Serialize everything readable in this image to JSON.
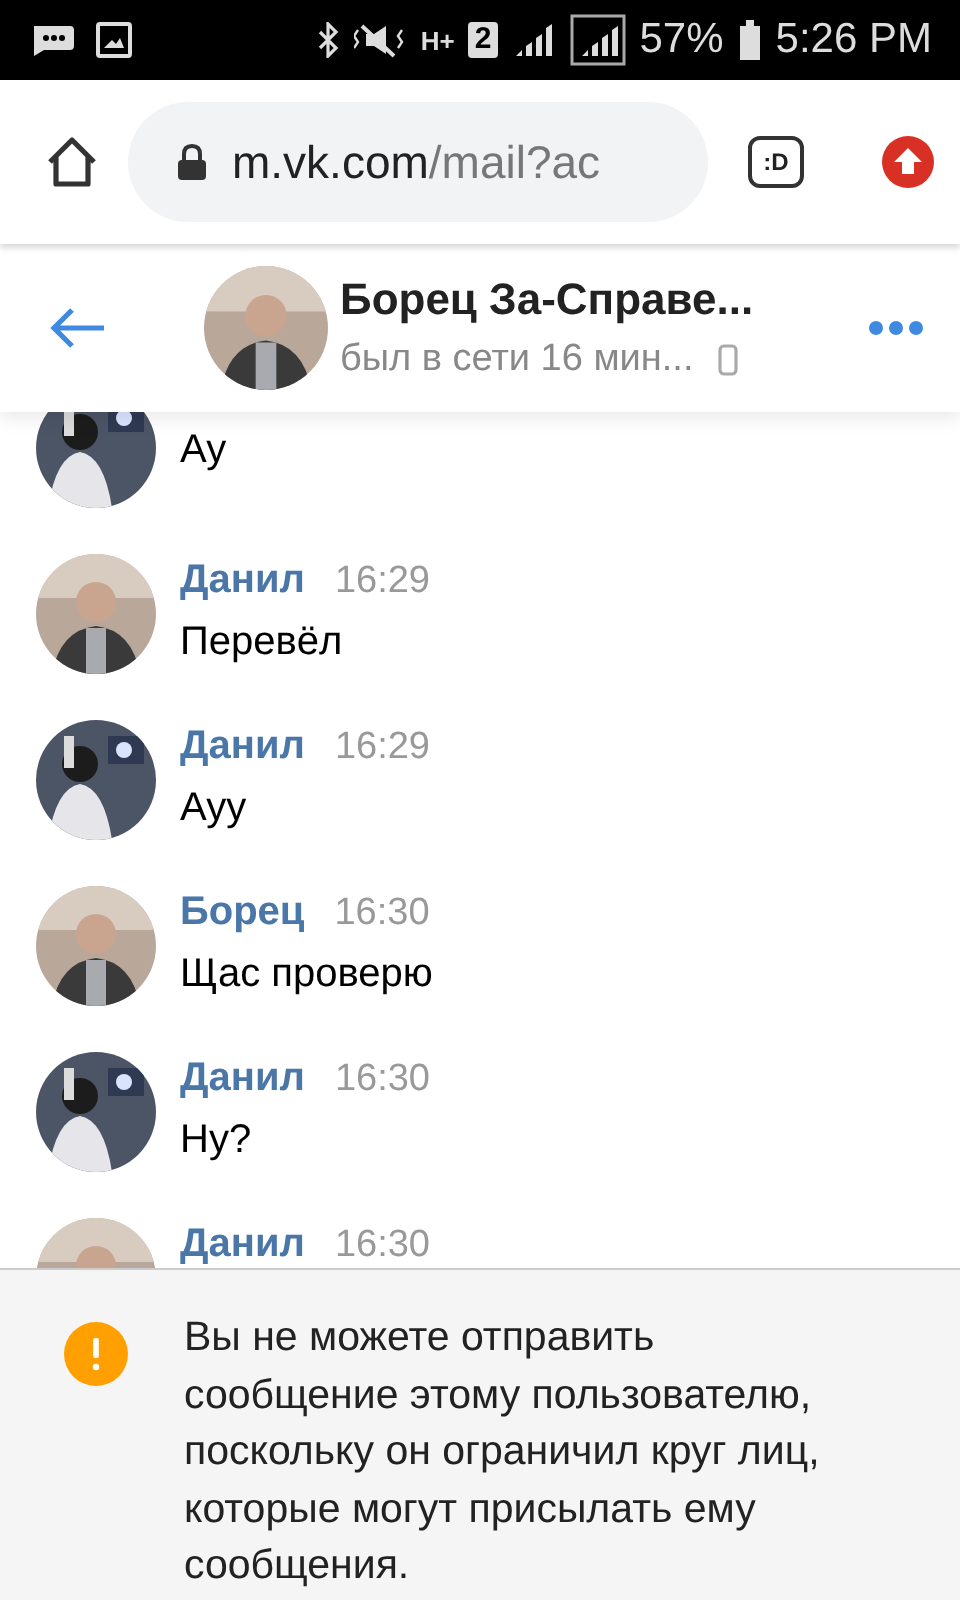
{
  "status_bar": {
    "network": "H+",
    "sim": "2",
    "battery": "57%",
    "time": "5:26 PM"
  },
  "browser": {
    "url_host": "m.vk.com",
    "url_path": "/mail?ac",
    "tab_button": ":D"
  },
  "chat_header": {
    "name": "Борец За-Справе...",
    "status": "был в сети 16 мин..."
  },
  "messages": [
    {
      "text": "Ау"
    },
    {
      "author": "Данил",
      "time": "16:29",
      "text": "Перевёл"
    },
    {
      "author": "Данил",
      "time": "16:29",
      "text": "Ауу"
    },
    {
      "author": "Борец",
      "time": "16:30",
      "text": "Щас проверю"
    },
    {
      "author": "Данил",
      "time": "16:30",
      "text": "Ну?"
    },
    {
      "author": "Данил",
      "time": "16:30"
    }
  ],
  "notice": {
    "text": "Вы не можете отправить сообщение этому пользователю, поскольку он ограничил круг лиц, которые могут присылать ему сообщения."
  }
}
